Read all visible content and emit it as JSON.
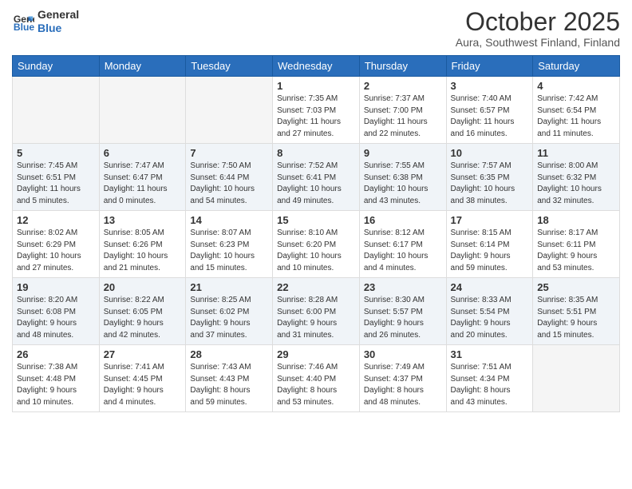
{
  "logo": {
    "line1": "General",
    "line2": "Blue"
  },
  "title": "October 2025",
  "location": "Aura, Southwest Finland, Finland",
  "weekdays": [
    "Sunday",
    "Monday",
    "Tuesday",
    "Wednesday",
    "Thursday",
    "Friday",
    "Saturday"
  ],
  "weeks": [
    [
      {
        "day": "",
        "info": ""
      },
      {
        "day": "",
        "info": ""
      },
      {
        "day": "",
        "info": ""
      },
      {
        "day": "1",
        "info": "Sunrise: 7:35 AM\nSunset: 7:03 PM\nDaylight: 11 hours\nand 27 minutes."
      },
      {
        "day": "2",
        "info": "Sunrise: 7:37 AM\nSunset: 7:00 PM\nDaylight: 11 hours\nand 22 minutes."
      },
      {
        "day": "3",
        "info": "Sunrise: 7:40 AM\nSunset: 6:57 PM\nDaylight: 11 hours\nand 16 minutes."
      },
      {
        "day": "4",
        "info": "Sunrise: 7:42 AM\nSunset: 6:54 PM\nDaylight: 11 hours\nand 11 minutes."
      }
    ],
    [
      {
        "day": "5",
        "info": "Sunrise: 7:45 AM\nSunset: 6:51 PM\nDaylight: 11 hours\nand 5 minutes."
      },
      {
        "day": "6",
        "info": "Sunrise: 7:47 AM\nSunset: 6:47 PM\nDaylight: 11 hours\nand 0 minutes."
      },
      {
        "day": "7",
        "info": "Sunrise: 7:50 AM\nSunset: 6:44 PM\nDaylight: 10 hours\nand 54 minutes."
      },
      {
        "day": "8",
        "info": "Sunrise: 7:52 AM\nSunset: 6:41 PM\nDaylight: 10 hours\nand 49 minutes."
      },
      {
        "day": "9",
        "info": "Sunrise: 7:55 AM\nSunset: 6:38 PM\nDaylight: 10 hours\nand 43 minutes."
      },
      {
        "day": "10",
        "info": "Sunrise: 7:57 AM\nSunset: 6:35 PM\nDaylight: 10 hours\nand 38 minutes."
      },
      {
        "day": "11",
        "info": "Sunrise: 8:00 AM\nSunset: 6:32 PM\nDaylight: 10 hours\nand 32 minutes."
      }
    ],
    [
      {
        "day": "12",
        "info": "Sunrise: 8:02 AM\nSunset: 6:29 PM\nDaylight: 10 hours\nand 27 minutes."
      },
      {
        "day": "13",
        "info": "Sunrise: 8:05 AM\nSunset: 6:26 PM\nDaylight: 10 hours\nand 21 minutes."
      },
      {
        "day": "14",
        "info": "Sunrise: 8:07 AM\nSunset: 6:23 PM\nDaylight: 10 hours\nand 15 minutes."
      },
      {
        "day": "15",
        "info": "Sunrise: 8:10 AM\nSunset: 6:20 PM\nDaylight: 10 hours\nand 10 minutes."
      },
      {
        "day": "16",
        "info": "Sunrise: 8:12 AM\nSunset: 6:17 PM\nDaylight: 10 hours\nand 4 minutes."
      },
      {
        "day": "17",
        "info": "Sunrise: 8:15 AM\nSunset: 6:14 PM\nDaylight: 9 hours\nand 59 minutes."
      },
      {
        "day": "18",
        "info": "Sunrise: 8:17 AM\nSunset: 6:11 PM\nDaylight: 9 hours\nand 53 minutes."
      }
    ],
    [
      {
        "day": "19",
        "info": "Sunrise: 8:20 AM\nSunset: 6:08 PM\nDaylight: 9 hours\nand 48 minutes."
      },
      {
        "day": "20",
        "info": "Sunrise: 8:22 AM\nSunset: 6:05 PM\nDaylight: 9 hours\nand 42 minutes."
      },
      {
        "day": "21",
        "info": "Sunrise: 8:25 AM\nSunset: 6:02 PM\nDaylight: 9 hours\nand 37 minutes."
      },
      {
        "day": "22",
        "info": "Sunrise: 8:28 AM\nSunset: 6:00 PM\nDaylight: 9 hours\nand 31 minutes."
      },
      {
        "day": "23",
        "info": "Sunrise: 8:30 AM\nSunset: 5:57 PM\nDaylight: 9 hours\nand 26 minutes."
      },
      {
        "day": "24",
        "info": "Sunrise: 8:33 AM\nSunset: 5:54 PM\nDaylight: 9 hours\nand 20 minutes."
      },
      {
        "day": "25",
        "info": "Sunrise: 8:35 AM\nSunset: 5:51 PM\nDaylight: 9 hours\nand 15 minutes."
      }
    ],
    [
      {
        "day": "26",
        "info": "Sunrise: 7:38 AM\nSunset: 4:48 PM\nDaylight: 9 hours\nand 10 minutes."
      },
      {
        "day": "27",
        "info": "Sunrise: 7:41 AM\nSunset: 4:45 PM\nDaylight: 9 hours\nand 4 minutes."
      },
      {
        "day": "28",
        "info": "Sunrise: 7:43 AM\nSunset: 4:43 PM\nDaylight: 8 hours\nand 59 minutes."
      },
      {
        "day": "29",
        "info": "Sunrise: 7:46 AM\nSunset: 4:40 PM\nDaylight: 8 hours\nand 53 minutes."
      },
      {
        "day": "30",
        "info": "Sunrise: 7:49 AM\nSunset: 4:37 PM\nDaylight: 8 hours\nand 48 minutes."
      },
      {
        "day": "31",
        "info": "Sunrise: 7:51 AM\nSunset: 4:34 PM\nDaylight: 8 hours\nand 43 minutes."
      },
      {
        "day": "",
        "info": ""
      }
    ]
  ]
}
